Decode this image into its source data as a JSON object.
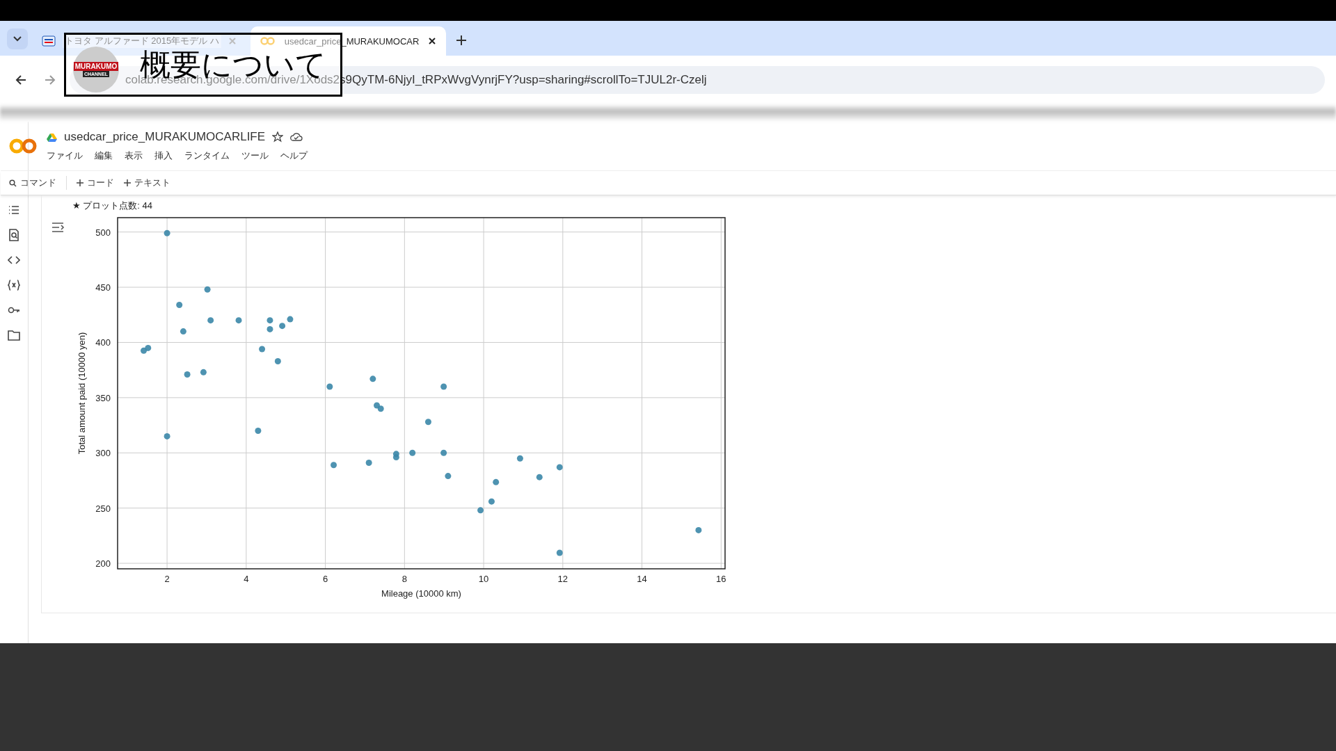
{
  "browser": {
    "tabs": [
      {
        "label": "トヨタ アルファード 2015年モデル ハ",
        "selected": false,
        "kind": "shop"
      },
      {
        "label": "usedcar_price_MURAKUMOCAR",
        "selected": true,
        "kind": "colab"
      }
    ],
    "url": "colab.research.google.com/drive/1Xods2s9QyTM-6NjyI_tRPxWvgVynrjFY?usp=sharing#scrollTo=TJUL2r-Czelj"
  },
  "overlay": {
    "logo_lines": [
      "MURAKUMO",
      "CHANNEL"
    ],
    "title": "概要について"
  },
  "notebook": {
    "title": "usedcar_price_MURAKUMOCARLIFE",
    "menu": [
      "ファイル",
      "編集",
      "表示",
      "挿入",
      "ランタイム",
      "ツール",
      "ヘルプ"
    ],
    "toolbar": [
      {
        "kind": "search",
        "label": "コマンド"
      },
      {
        "kind": "add",
        "label": "コード"
      },
      {
        "kind": "add",
        "label": "テキスト"
      }
    ],
    "sidebar": [
      {
        "kind": "toc"
      },
      {
        "kind": "find"
      },
      {
        "kind": "code"
      },
      {
        "kind": "variables"
      },
      {
        "kind": "secrets"
      },
      {
        "kind": "files"
      }
    ]
  },
  "output": {
    "note": "★ プロット点数: 44",
    "chart_data": {
      "type": "scatter",
      "grid": true,
      "xlabel": "Mileage (10000 km)",
      "ylabel": "Total amount paid (10000 yen)",
      "xlim": [
        0.75,
        16.1
      ],
      "ylim": [
        195,
        513
      ],
      "xticks": [
        2,
        4,
        6,
        8,
        10,
        12,
        14,
        16
      ],
      "yticks": [
        200,
        250,
        300,
        350,
        400,
        450,
        500
      ],
      "x": [
        1.41,
        1.52,
        2.0,
        2.0,
        2.31,
        2.41,
        2.51,
        2.92,
        3.02,
        3.1,
        3.81,
        4.3,
        4.4,
        4.6,
        4.6,
        4.8,
        4.91,
        5.11,
        6.11,
        6.21,
        7.1,
        7.2,
        7.3,
        7.4,
        7.79,
        7.79,
        8.2,
        8.6,
        8.99,
        8.99,
        9.1,
        9.92,
        10.2,
        10.31,
        10.92,
        11.41,
        11.92,
        11.92,
        15.43
      ],
      "series": [
        {
          "color": "#3b87a8",
          "values": [
            392.6,
            395,
            499,
            315,
            434,
            410,
            371,
            373,
            448,
            420,
            420,
            320,
            394,
            420,
            412,
            383,
            415,
            421,
            360,
            289,
            291,
            367,
            343,
            340,
            299,
            296,
            300,
            328,
            360,
            300,
            279,
            248,
            256,
            273.5,
            295,
            278,
            287,
            209.5,
            230
          ]
        }
      ]
    }
  }
}
